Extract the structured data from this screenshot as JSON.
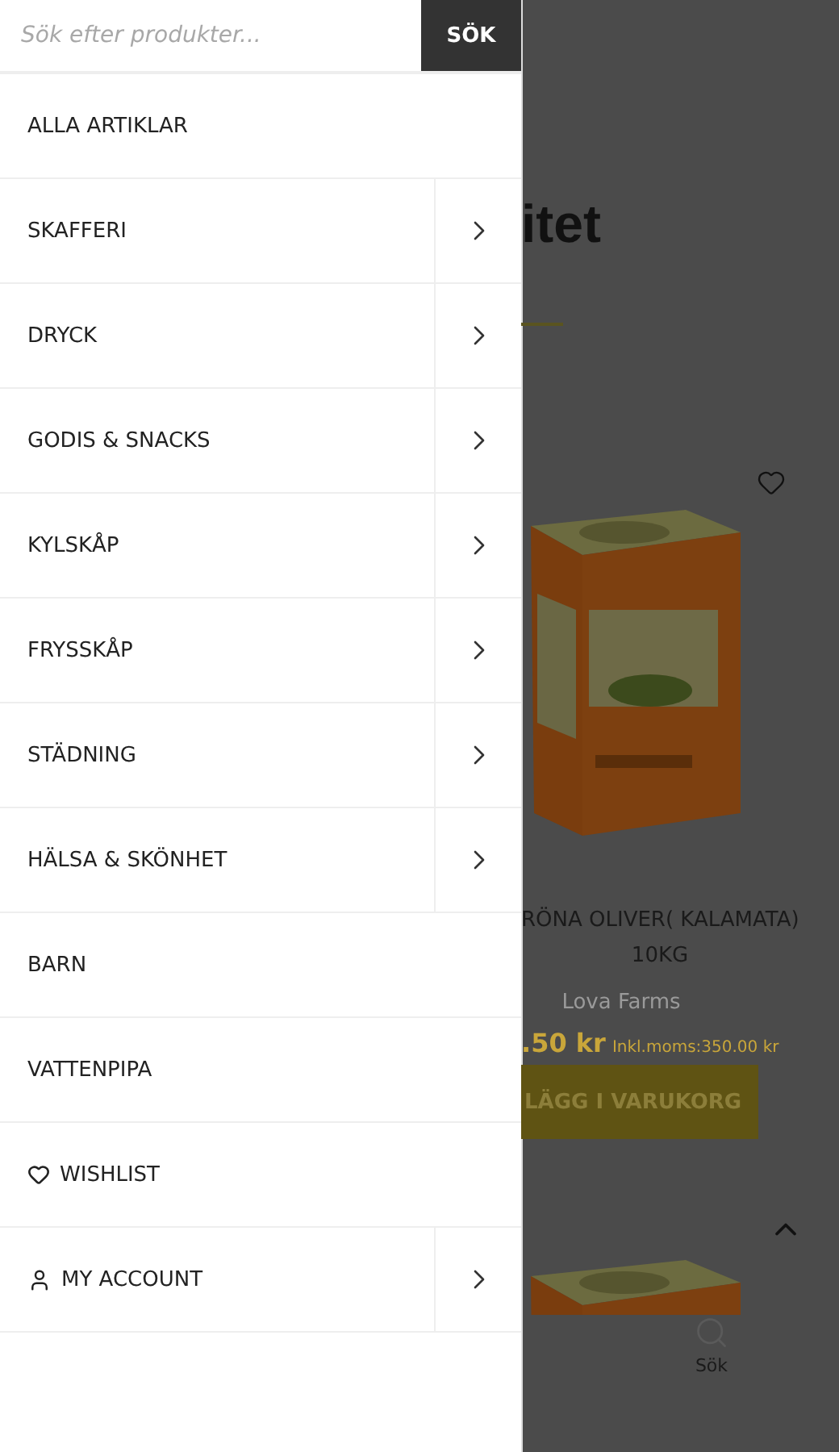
{
  "search": {
    "placeholder": "Sök efter produkter...",
    "button": "SÖK"
  },
  "menu": [
    {
      "label": "ALLA ARTIKLAR",
      "kind": "plain",
      "has_submenu": false
    },
    {
      "label": "SKAFFERI",
      "kind": "plain",
      "has_submenu": true
    },
    {
      "label": "DRYCK",
      "kind": "plain",
      "has_submenu": true
    },
    {
      "label": "GODIS & SNACKS",
      "kind": "plain",
      "has_submenu": true
    },
    {
      "label": "KYLSKÅP",
      "kind": "plain",
      "has_submenu": true
    },
    {
      "label": "FRYSSKÅP",
      "kind": "plain",
      "has_submenu": true
    },
    {
      "label": "STÄDNING",
      "kind": "plain",
      "has_submenu": true
    },
    {
      "label": "HÄLSA & SKÖNHET",
      "kind": "plain",
      "has_submenu": true
    },
    {
      "label": "BARN",
      "kind": "plain",
      "has_submenu": false
    },
    {
      "label": "VATTENPIPA",
      "kind": "plain",
      "has_submenu": false
    },
    {
      "label": "WISHLIST",
      "kind": "wishlist",
      "has_submenu": false
    },
    {
      "label": "MY ACCOUNT",
      "kind": "account",
      "has_submenu": true
    }
  ],
  "page": {
    "heading": "itet",
    "product": {
      "name": "RÖNA OLIVER( KALAMATA)",
      "size": "10KG",
      "brand": "Lova Farms",
      "price": ".50 kr",
      "tax_note": "Inkl.moms:350.00 kr",
      "button": "LÄGG I VARUKORG"
    },
    "bottom_nav": [
      {
        "label": "Sök"
      }
    ]
  }
}
